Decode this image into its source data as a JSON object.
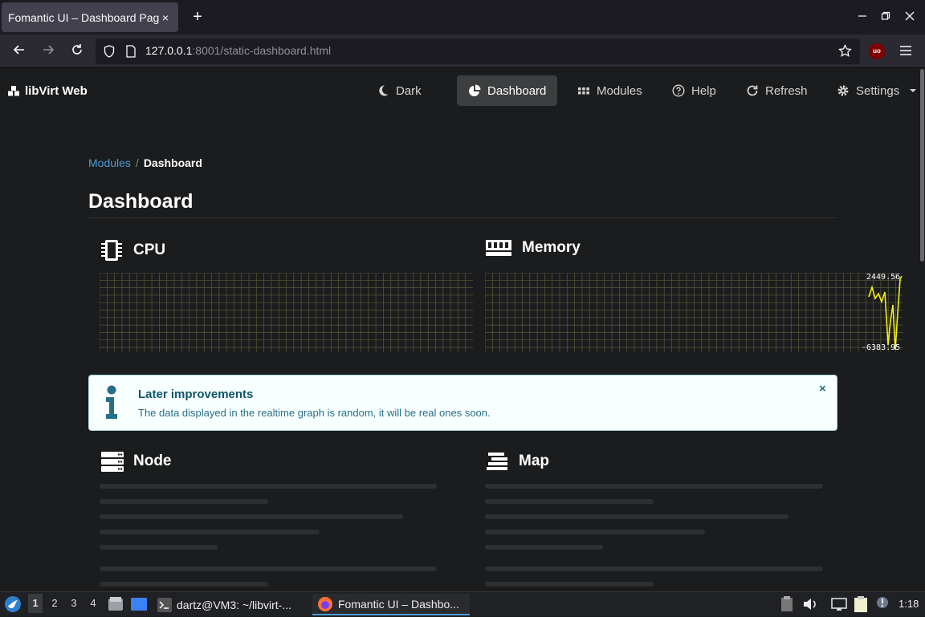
{
  "browser": {
    "tab_title": "Fomantic UI – Dashboard Page",
    "tab_close": "×",
    "new_tab": "+",
    "url_host": "127.0.0.1",
    "url_rest": ":8001/static-dashboard.html",
    "ublock_label": "uo"
  },
  "menu": {
    "brand": "libVirt Web",
    "dark": "Dark",
    "dashboard": "Dashboard",
    "modules": "Modules",
    "help": "Help",
    "refresh": "Refresh",
    "settings": "Settings"
  },
  "breadcrumb": {
    "link": "Modules",
    "sep": "/",
    "active": "Dashboard"
  },
  "page_title": "Dashboard",
  "sections": {
    "cpu": "CPU",
    "memory": "Memory",
    "node": "Node",
    "map": "Map"
  },
  "memory_graph": {
    "max_label": "2449.56",
    "min_label": "-6383.95",
    "line_color": "#f2f20e"
  },
  "message": {
    "header": "Later improvements",
    "text": "The data displayed in the realtime graph is random, it will be real ones soon.",
    "close": "×"
  },
  "taskbar": {
    "workspaces": [
      "1",
      "2",
      "3",
      "4"
    ],
    "terminal_task": "dartz@VM3: ~/libvirt-...",
    "firefox_task": "Fomantic UI – Dashbo...",
    "clock": "1:18"
  },
  "colors": {
    "accent": "#4e9bd3",
    "info_bg": "#f8ffff",
    "info_text": "#276f86",
    "grid": "#595a3a"
  }
}
